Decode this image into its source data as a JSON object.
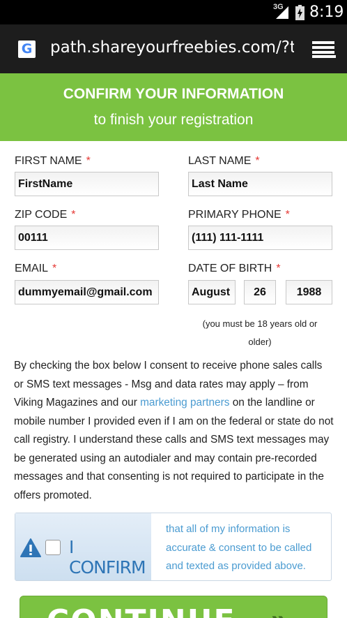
{
  "status_bar": {
    "network": "3G",
    "time": "8:19"
  },
  "browser": {
    "url": "path.shareyourfreebies.com/?tr",
    "google_letter": "G"
  },
  "banner": {
    "title": "CONFIRM YOUR INFORMATION",
    "subtitle": "to finish your registration"
  },
  "form": {
    "required_marker": "*",
    "first_name": {
      "label": "FIRST NAME",
      "value": "FirstName"
    },
    "last_name": {
      "label": "LAST NAME",
      "value": "Last Name"
    },
    "zip_code": {
      "label": "ZIP CODE",
      "value": "00111"
    },
    "primary_phone": {
      "label": "PRIMARY PHONE",
      "value": "(111) 111-1111"
    },
    "email": {
      "label": "EMAIL",
      "value": "dummyemail@gmail.com"
    },
    "dob": {
      "label": "DATE OF BIRTH",
      "month": "August",
      "day": "26",
      "year": "1988"
    },
    "age_note_line1": "(you must be 18 years old or",
    "age_note_line2": "older)"
  },
  "consent": {
    "before_link": "By checking the box below I consent to receive phone sales calls or SMS text messages - Msg and data rates may apply – from Viking Magazines and our ",
    "link": "marketing partners",
    "after_link": " on the landline or mobile number I provided even if I am on the federal or state do not call registry. I understand these calls and SMS text messages may be generated using an autodialer and may contain pre-recorded messages and that consenting is not required to participate in the offers promoted."
  },
  "confirm": {
    "label": "I CONFIRM",
    "checked": false,
    "text": "that all of my information is accurate & consent to be called and texted as provided above."
  },
  "continue_button": {
    "label": "CONTINUE",
    "chevrons": "»"
  },
  "colors": {
    "green": "#7bc241",
    "blue_text": "#4a9bd1",
    "confirm_blue": "#2e75b6",
    "required": "#e53935"
  }
}
